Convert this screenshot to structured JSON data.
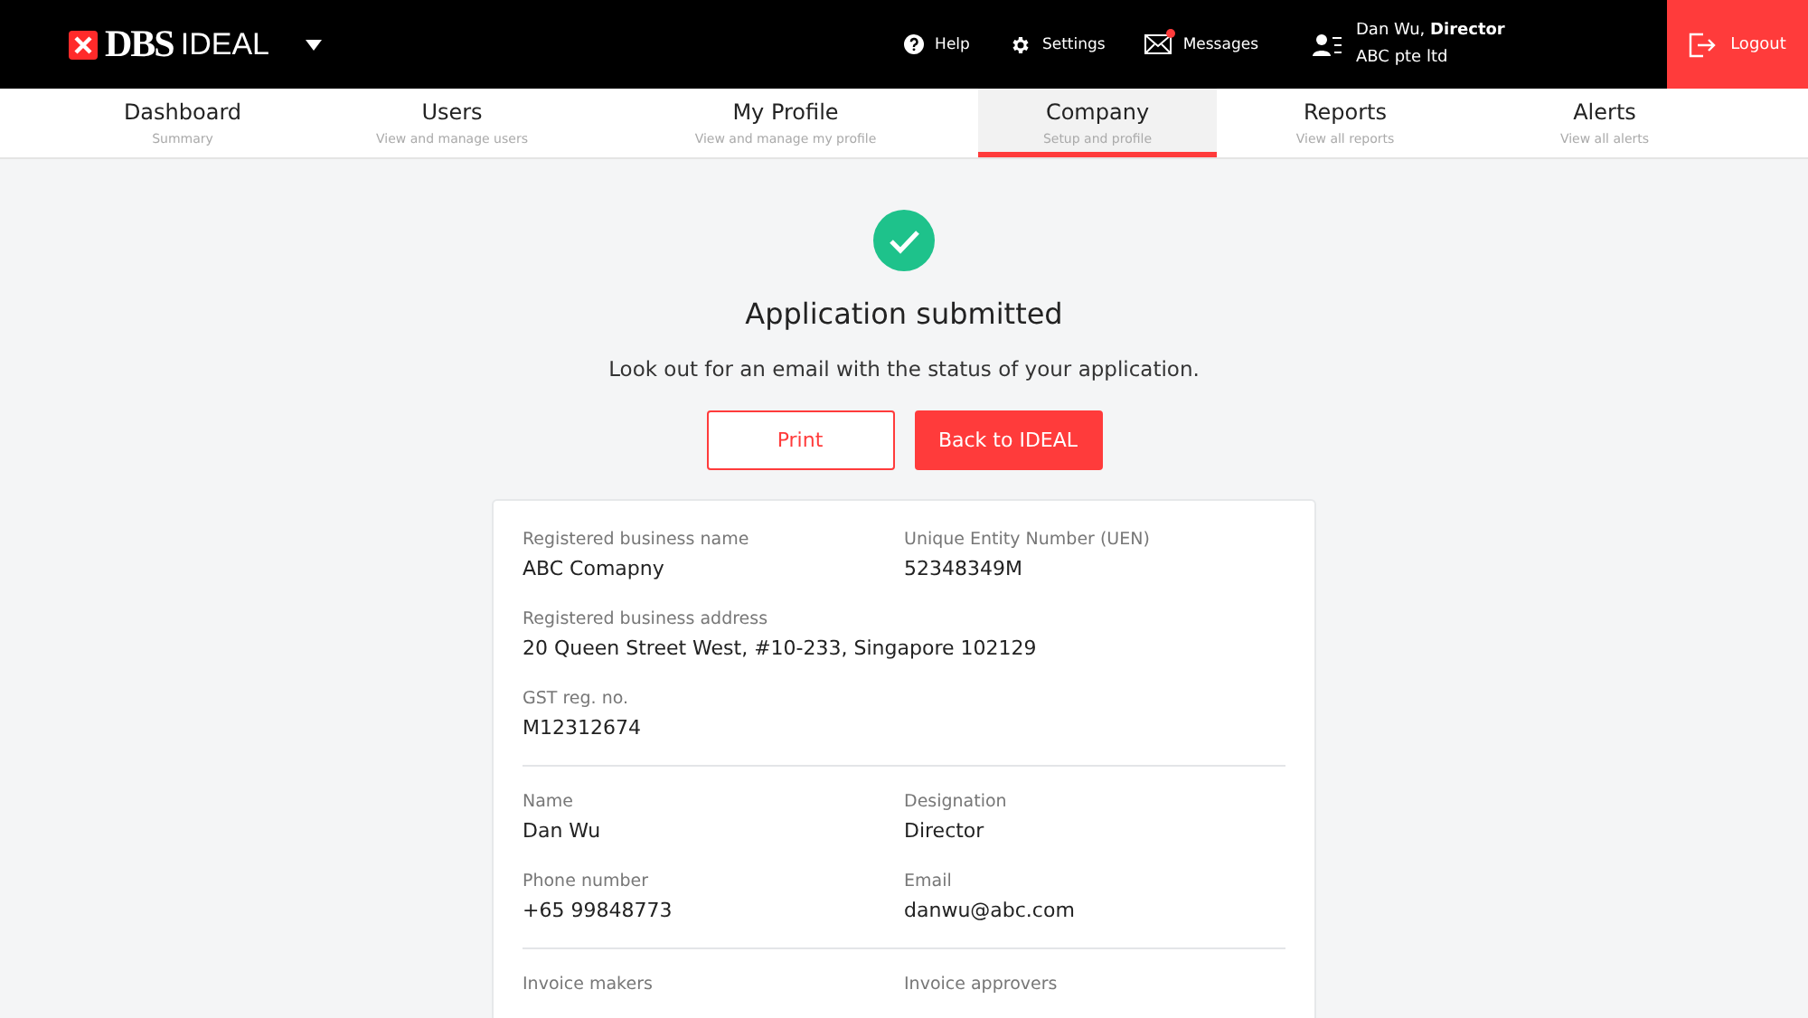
{
  "header": {
    "logo": {
      "brand": "DBS",
      "product": "IDEAL"
    },
    "actions": [
      {
        "kind": "help",
        "label": "Help",
        "notification": false
      },
      {
        "kind": "settings",
        "label": "Settings",
        "notification": false
      },
      {
        "kind": "messages",
        "label": "Messages",
        "notification": true
      }
    ],
    "user": {
      "name": "Dan Wu, **Director**",
      "company": "ABC pte ltd"
    },
    "logout": "Logout"
  },
  "nav": [
    {
      "label": "Dashboard",
      "sub": "Summary",
      "selected": false
    },
    {
      "label": "Users",
      "sub": "View and manage users",
      "selected": false
    },
    {
      "label": "My Profile",
      "sub": "View and manage my profile",
      "selected": false
    },
    {
      "label": "Company",
      "sub": "Setup and profile",
      "selected": true
    },
    {
      "label": "Reports",
      "sub": "View all reports",
      "selected": false
    },
    {
      "label": "Alerts",
      "sub": "View all alerts",
      "selected": false
    }
  ],
  "result": {
    "title": "Application submitted",
    "message": "Look out for an email with the status of your application.",
    "buttons": [
      {
        "kind": "secondary",
        "label": "Print"
      },
      {
        "kind": "primary",
        "label": "Back to IDEAL"
      }
    ]
  },
  "sections": [
    {
      "rows": [
        [
          {
            "label": "Registered business name",
            "value": "ABC Comapny"
          },
          {
            "label": "Unique Entity Number (UEN)",
            "value": "52348349M"
          }
        ],
        [
          {
            "label": "Registered business address",
            "value": "20 Queen Street West, #10-233, Singapore 102129"
          }
        ],
        [
          {
            "label": "GST reg. no.",
            "value": "M12312674"
          }
        ]
      ]
    },
    {
      "rows": [
        [
          {
            "label": "Name",
            "value": "Dan Wu"
          },
          {
            "label": "Designation",
            "value": "Director"
          }
        ],
        [
          {
            "label": "Phone number",
            "value": "+65 99848773"
          },
          {
            "label": "Email",
            "value": "danwu@abc.com"
          }
        ]
      ]
    },
    {
      "rows": [
        [
          {
            "label": "Invoice makers"
          },
          {
            "label": "Invoice approvers"
          }
        ]
      ]
    }
  ]
}
